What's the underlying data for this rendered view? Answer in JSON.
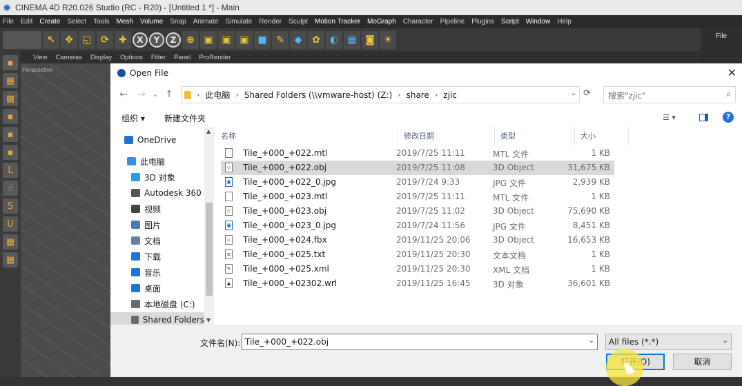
{
  "c4d": {
    "title": "CINEMA 4D R20.026 Studio (RC - R20) - [Untitled 1 *] - Main",
    "menu": [
      "File",
      "Edit",
      "Create",
      "Select",
      "Tools",
      "Mesh",
      "Volume",
      "Snap",
      "Animate",
      "Simulate",
      "Render",
      "Sculpt",
      "Motion Tracker",
      "MoGraph",
      "Character",
      "Pipeline",
      "Plugins",
      "Script",
      "Window",
      "Help"
    ],
    "view_menu": [
      "View",
      "Cameras",
      "Display",
      "Options",
      "Filter",
      "Panel",
      "ProRender"
    ],
    "viewport_label": "Perspective",
    "right_panel_file": "File"
  },
  "dialog": {
    "title": "Open File",
    "close": "✕",
    "breadcrumb": [
      "此电脑",
      "Shared Folders (\\\\vmware-host) (Z:)",
      "share",
      "zjic"
    ],
    "search_placeholder": "搜索\"zjic\"",
    "toolbar": {
      "organize": "组织 ▾",
      "new_folder": "新建文件夹"
    },
    "nav_items": [
      {
        "label": "OneDrive",
        "color": "#1e73d6"
      },
      {
        "label": "此电脑",
        "color": "#3a8ee6"
      },
      {
        "label": "3D 对象",
        "color": "#2d9be0"
      },
      {
        "label": "Autodesk 360",
        "color": "#555555"
      },
      {
        "label": "视频",
        "color": "#444444"
      },
      {
        "label": "图片",
        "color": "#4a7ab8"
      },
      {
        "label": "文档",
        "color": "#6a7fa0"
      },
      {
        "label": "下载",
        "color": "#1e73d6"
      },
      {
        "label": "音乐",
        "color": "#1e73d6"
      },
      {
        "label": "桌面",
        "color": "#1e73d6"
      },
      {
        "label": "本地磁盘 (C:)",
        "color": "#6a6a6a"
      },
      {
        "label": "Shared Folders",
        "color": "#6a6a6a"
      }
    ],
    "columns": {
      "name": "名称",
      "date": "修改日期",
      "type": "类型",
      "size": "大小"
    },
    "files": [
      {
        "name": "Tile_+000_+022.mtl",
        "date": "2019/7/25 11:11",
        "type": "MTL 文件",
        "size": "1 KB",
        "icon": "doc-icon"
      },
      {
        "name": "Tile_+000_+022.obj",
        "date": "2019/7/25 11:08",
        "type": "3D Object",
        "size": "31,675 KB",
        "icon": "3d-object-icon"
      },
      {
        "name": "Tile_+000_+022_0.jpg",
        "date": "2019/7/24 9:33",
        "type": "JPG 文件",
        "size": "2,939 KB",
        "icon": "image-icon"
      },
      {
        "name": "Tile_+000_+023.mtl",
        "date": "2019/7/25 11:11",
        "type": "MTL 文件",
        "size": "1 KB",
        "icon": "doc-icon"
      },
      {
        "name": "Tile_+000_+023.obj",
        "date": "2019/7/25 11:02",
        "type": "3D Object",
        "size": "75,690 KB",
        "icon": "3d-object-icon"
      },
      {
        "name": "Tile_+000_+023_0.jpg",
        "date": "2019/7/24 11:56",
        "type": "JPG 文件",
        "size": "8,451 KB",
        "icon": "image-icon"
      },
      {
        "name": "Tile_+000_+024.fbx",
        "date": "2019/11/25 20:06",
        "type": "3D Object",
        "size": "16,653 KB",
        "icon": "3d-object-icon"
      },
      {
        "name": "Tile_+000_+025.txt",
        "date": "2019/11/25 20:30",
        "type": "文本文档",
        "size": "1 KB",
        "icon": "text-icon"
      },
      {
        "name": "Tile_+000_+025.xml",
        "date": "2019/11/25 20:30",
        "type": "XML 文档",
        "size": "1 KB",
        "icon": "xml-icon"
      },
      {
        "name": "Tile_+000_+02302.wrl",
        "date": "2019/11/25 16:45",
        "type": "3D 对象",
        "size": "36,601 KB",
        "icon": "wrl-icon"
      }
    ],
    "selected_file_index": 1,
    "filename_label": "文件名(N):",
    "filename_value": "Tile_+000_+022.obj",
    "filetype_value": "All files (*.*)",
    "open_button": "打开(O)",
    "cancel_button": "取消"
  }
}
